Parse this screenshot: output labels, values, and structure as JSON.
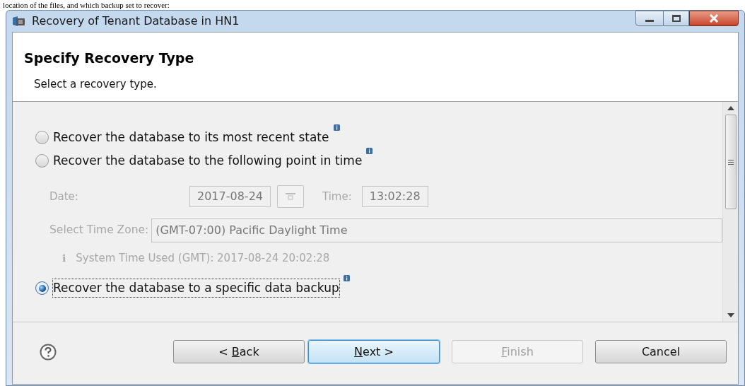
{
  "document_text": "location of the files, and which backup set to recover:",
  "window": {
    "title": "Recovery of Tenant Database in HN1"
  },
  "header": {
    "title": "Specify Recovery Type",
    "subtitle": "Select a recovery type."
  },
  "options": [
    {
      "label": "Recover the database to its most recent state",
      "selected": false,
      "focused": false
    },
    {
      "label": "Recover the database to the following point in time",
      "selected": false,
      "focused": false
    },
    {
      "label": "Recover the database to a specific data backup",
      "selected": true,
      "focused": true
    }
  ],
  "point_in_time": {
    "disabled": true,
    "date_label": "Date:",
    "date": "2017-08-24",
    "time_label": "Time:",
    "time": "13:02:28",
    "timezone_label": "Select Time Zone:",
    "timezone": "(GMT-07:00) Pacific Daylight Time",
    "info_glyph": "ℹ",
    "system_time": "System Time Used (GMT): 2017-08-24 20:02:28"
  },
  "buttons": [
    {
      "before": "< ",
      "mnemonic": "B",
      "after": "ack",
      "disabled": false,
      "default": false
    },
    {
      "mnemonic": "N",
      "after": "ext >",
      "disabled": false,
      "default": true
    },
    {
      "mnemonic": "F",
      "after": "inish",
      "disabled": true,
      "default": false
    },
    {
      "label": "Cancel",
      "disabled": false,
      "default": false
    }
  ]
}
